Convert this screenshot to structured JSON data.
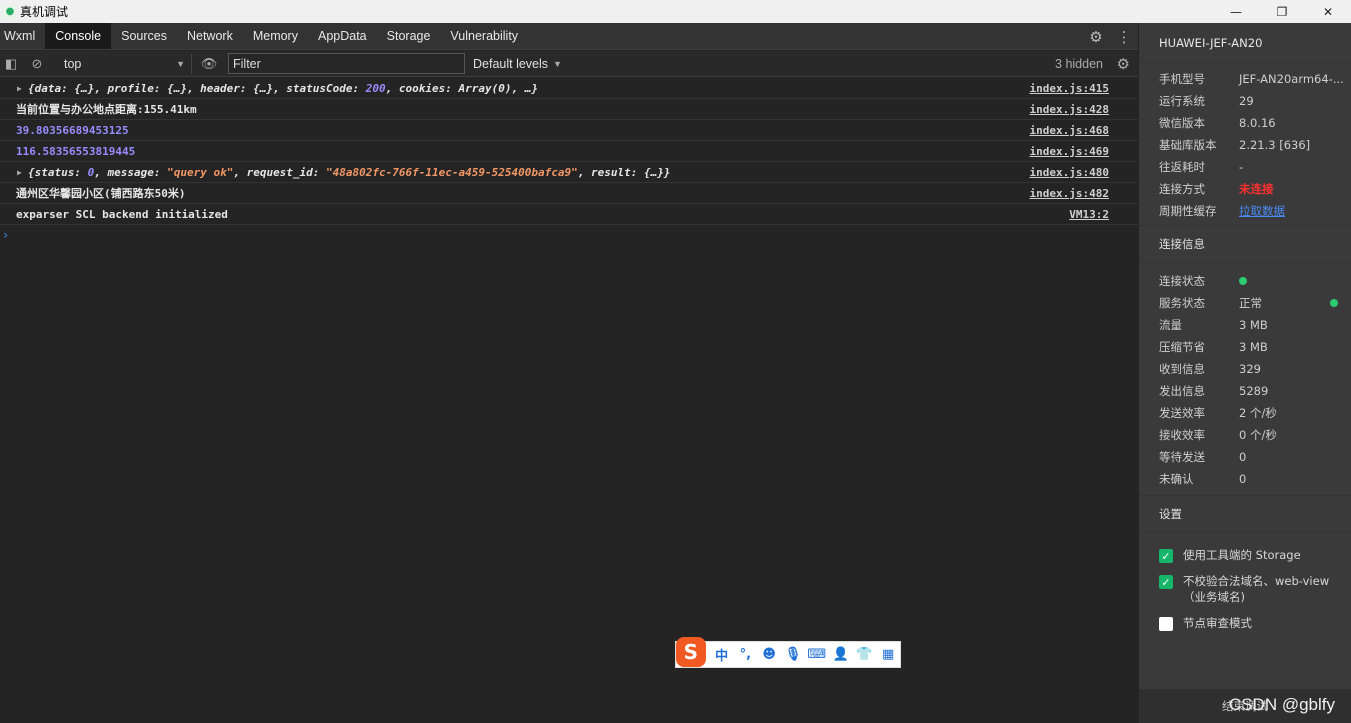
{
  "window": {
    "title": "真机调试",
    "minimize": "—",
    "maximize": "❐",
    "close": "✕"
  },
  "tabs": [
    "Wxml",
    "Console",
    "Sources",
    "Network",
    "Memory",
    "AppData",
    "Storage",
    "Vulnerability"
  ],
  "active_tab": "Console",
  "toolbar": {
    "context": "top",
    "filter_placeholder": "Filter",
    "levels": "Default levels",
    "hidden": "3 hidden"
  },
  "console": {
    "rows": [
      {
        "expandable": true,
        "parts": [
          {
            "t": "{data: {…}, profile: {…}, header: {…}, statusCode: ",
            "c": "it"
          },
          {
            "t": "200",
            "c": "it num"
          },
          {
            "t": ", cookies: Array(0), …}",
            "c": "it"
          }
        ],
        "src": "index.js:415"
      },
      {
        "expandable": false,
        "parts": [
          {
            "t": "当前位置与办公地点距离:155.41km",
            "c": ""
          }
        ],
        "src": "index.js:428"
      },
      {
        "expandable": false,
        "parts": [
          {
            "t": "39.80356689453125",
            "c": "num"
          }
        ],
        "src": "index.js:468"
      },
      {
        "expandable": false,
        "parts": [
          {
            "t": "116.58356553819445",
            "c": "num"
          }
        ],
        "src": "index.js:469"
      },
      {
        "expandable": true,
        "parts": [
          {
            "t": "{status: ",
            "c": "it"
          },
          {
            "t": "0",
            "c": "it num"
          },
          {
            "t": ", message: ",
            "c": "it"
          },
          {
            "t": "\"query ok\"",
            "c": "it str"
          },
          {
            "t": ", request_id: ",
            "c": "it"
          },
          {
            "t": "\"48a802fc-766f-11ec-a459-525400bafca9\"",
            "c": "it str"
          },
          {
            "t": ", result: {…}}",
            "c": "it"
          }
        ],
        "src": "index.js:480"
      },
      {
        "expandable": false,
        "parts": [
          {
            "t": "通州区华馨园小区(铺西路东50米)",
            "c": ""
          }
        ],
        "src": "index.js:482"
      },
      {
        "expandable": false,
        "parts": [
          {
            "t": "exparser SCL backend initialized",
            "c": ""
          }
        ],
        "src": "VM13:2"
      }
    ],
    "prompt": "›"
  },
  "sidebar": {
    "device_name": "HUAWEI-JEF-AN20",
    "device_info": [
      {
        "k": "手机型号",
        "v": "JEF-AN20arm64-...",
        "style": ""
      },
      {
        "k": "运行系统",
        "v": "29",
        "style": ""
      },
      {
        "k": "微信版本",
        "v": "8.0.16",
        "style": ""
      },
      {
        "k": "基础库版本",
        "v": "2.21.3 [636]",
        "style": ""
      },
      {
        "k": "往返耗时",
        "v": "-",
        "style": ""
      },
      {
        "k": "连接方式",
        "v": "未连接",
        "style": "red"
      },
      {
        "k": "周期性缓存",
        "v": "拉取数据",
        "style": "link"
      }
    ],
    "conn_heading": "连接信息",
    "conn_info": [
      {
        "k": "连接状态",
        "v": "",
        "dot": "inline"
      },
      {
        "k": "服务状态",
        "v": "正常",
        "dot": "right"
      },
      {
        "k": "流量",
        "v": "3 MB"
      },
      {
        "k": "压缩节省",
        "v": "3 MB"
      },
      {
        "k": "收到信息",
        "v": "329"
      },
      {
        "k": "发出信息",
        "v": "5289"
      },
      {
        "k": "发送效率",
        "v": "2 个/秒"
      },
      {
        "k": "接收效率",
        "v": "0 个/秒"
      },
      {
        "k": "等待发送",
        "v": "0"
      },
      {
        "k": "未确认",
        "v": "0"
      }
    ],
    "settings_heading": "设置",
    "settings": [
      {
        "label": "使用工具端的 Storage",
        "checked": true
      },
      {
        "label": "不校验合法域名、web-view（业务域名)",
        "checked": true
      },
      {
        "label": "节点审查模式",
        "checked": false
      }
    ],
    "footer": "结束调试",
    "status_color": "#2ecc71",
    "error_color": "#ff3030",
    "link_color": "#4a8cf7"
  },
  "ime": {
    "logo": "S",
    "mode": "中",
    "punct": "°,"
  },
  "watermark": "CSDN @gblfy"
}
